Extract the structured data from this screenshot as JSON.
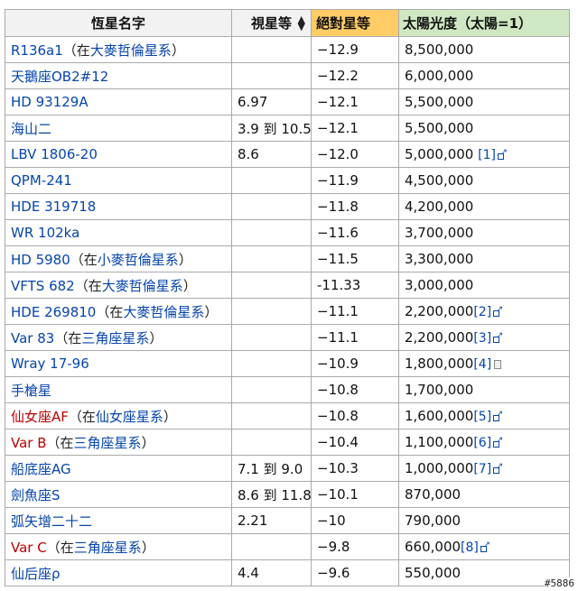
{
  "headers": {
    "name": "恆星名字",
    "apparent": "視星等",
    "absolute": "絕對星等",
    "luminosity": "太陽光度（太陽=1）"
  },
  "rows": [
    {
      "name": "R136a1",
      "paren_pre": "（在",
      "paren_link": "大麥哲倫星系",
      "paren_post": "）",
      "name_color": "blue",
      "apparent": "",
      "absolute": "−12.9",
      "luminosity": "8,500,000",
      "ref": "",
      "ref_icon": ""
    },
    {
      "name": "天鵝座OB2#12",
      "paren_pre": "",
      "paren_link": "",
      "paren_post": "",
      "name_color": "blue",
      "apparent": "",
      "absolute": "−12.2",
      "luminosity": "6,000,000",
      "ref": "",
      "ref_icon": ""
    },
    {
      "name": "HD 93129A",
      "paren_pre": "",
      "paren_link": "",
      "paren_post": "",
      "name_color": "blue",
      "apparent": "6.97",
      "absolute": "−12.1",
      "luminosity": "5,500,000",
      "ref": "",
      "ref_icon": ""
    },
    {
      "name": "海山二",
      "paren_pre": "",
      "paren_link": "",
      "paren_post": "",
      "name_color": "blue",
      "apparent": "3.9 到 10.5",
      "absolute": "−12.1",
      "luminosity": "5,500,000",
      "ref": "",
      "ref_icon": ""
    },
    {
      "name": "LBV 1806-20",
      "paren_pre": "",
      "paren_link": "",
      "paren_post": "",
      "name_color": "blue",
      "apparent": "8.6",
      "absolute": "−12.0",
      "luminosity": "5,000,000 ",
      "ref": "[1]",
      "ref_icon": "external"
    },
    {
      "name": "QPM-241",
      "paren_pre": "",
      "paren_link": "",
      "paren_post": "",
      "name_color": "blue",
      "apparent": "",
      "absolute": "−11.9",
      "luminosity": "4,500,000",
      "ref": "",
      "ref_icon": ""
    },
    {
      "name": "HDE 319718",
      "paren_pre": "",
      "paren_link": "",
      "paren_post": "",
      "name_color": "blue",
      "apparent": "",
      "absolute": "−11.8",
      "luminosity": "4,200,000",
      "ref": "",
      "ref_icon": ""
    },
    {
      "name": "WR 102ka",
      "paren_pre": "",
      "paren_link": "",
      "paren_post": "",
      "name_color": "blue",
      "apparent": "",
      "absolute": "−11.6",
      "luminosity": "3,700,000",
      "ref": "",
      "ref_icon": ""
    },
    {
      "name": "HD 5980",
      "paren_pre": "（在",
      "paren_link": "小麥哲倫星系",
      "paren_post": "）",
      "name_color": "blue",
      "apparent": "",
      "absolute": "−11.5",
      "luminosity": "3,300,000",
      "ref": "",
      "ref_icon": ""
    },
    {
      "name": "VFTS 682",
      "paren_pre": "（在",
      "paren_link": "大麥哲倫星系",
      "paren_post": "）",
      "name_color": "blue",
      "apparent": "",
      "absolute": "-11.33",
      "luminosity": "3,000,000",
      "ref": "",
      "ref_icon": ""
    },
    {
      "name": "HDE 269810",
      "paren_pre": "（在",
      "paren_link": "大麥哲倫星系",
      "paren_post": "）",
      "name_color": "blue",
      "apparent": "",
      "absolute": "−11.1",
      "luminosity": "2,200,000",
      "ref": "[2]",
      "ref_icon": "external"
    },
    {
      "name": "Var 83",
      "paren_pre": "（在",
      "paren_link": "三角座星系",
      "paren_post": "）",
      "name_color": "blue",
      "apparent": "",
      "absolute": "−11.1",
      "luminosity": "2,200,000",
      "ref": "[3]",
      "ref_icon": "external"
    },
    {
      "name": "Wray 17-96",
      "paren_pre": "",
      "paren_link": "",
      "paren_post": "",
      "name_color": "blue",
      "apparent": "",
      "absolute": "−10.9",
      "luminosity": "1,800,000",
      "ref": "[4]",
      "ref_icon": "document"
    },
    {
      "name": "手槍星",
      "paren_pre": "",
      "paren_link": "",
      "paren_post": "",
      "name_color": "blue",
      "apparent": "",
      "absolute": "−10.8",
      "luminosity": "1,700,000",
      "ref": "",
      "ref_icon": ""
    },
    {
      "name": "仙女座AF",
      "paren_pre": "（在",
      "paren_link": "仙女座星系",
      "paren_post": "）",
      "name_color": "red",
      "apparent": "",
      "absolute": "−10.8",
      "luminosity": "1,600,000",
      "ref": "[5]",
      "ref_icon": "external"
    },
    {
      "name": "Var B",
      "paren_pre": "（在",
      "paren_link": "三角座星系",
      "paren_post": "）",
      "name_color": "red",
      "apparent": "",
      "absolute": "−10.4",
      "luminosity": "1,100,000",
      "ref": "[6]",
      "ref_icon": "external"
    },
    {
      "name": "船底座AG",
      "paren_pre": "",
      "paren_link": "",
      "paren_post": "",
      "name_color": "blue",
      "apparent": "7.1 到 9.0",
      "absolute": "−10.3",
      "luminosity": "1,000,000",
      "ref": "[7]",
      "ref_icon": "external"
    },
    {
      "name": "劍魚座S",
      "paren_pre": "",
      "paren_link": "",
      "paren_post": "",
      "name_color": "blue",
      "apparent": "8.6 到 11.8",
      "absolute": "−10.1",
      "luminosity": "870,000",
      "ref": "",
      "ref_icon": ""
    },
    {
      "name": "弧矢增二十二",
      "paren_pre": "",
      "paren_link": "",
      "paren_post": "",
      "name_color": "blue",
      "apparent": "2.21",
      "absolute": "−10",
      "luminosity": "790,000",
      "ref": "",
      "ref_icon": ""
    },
    {
      "name": "Var C",
      "paren_pre": "（在",
      "paren_link": "三角座星系",
      "paren_post": "）",
      "name_color": "red",
      "apparent": "",
      "absolute": "−9.8",
      "luminosity": "660,000",
      "ref": "[8]",
      "ref_icon": "external"
    },
    {
      "name": "仙后座ρ",
      "paren_pre": "",
      "paren_link": "",
      "paren_post": "",
      "name_color": "blue",
      "apparent": "4.4",
      "absolute": "−9.6",
      "luminosity": "550,000",
      "ref": "",
      "ref_icon": ""
    }
  ],
  "watermark": "#5886",
  "colors": {
    "link": "#0645ad",
    "redlink": "#ba0000",
    "absmag_header": "#ffcc66",
    "lum_header": "#cfe8c3"
  }
}
